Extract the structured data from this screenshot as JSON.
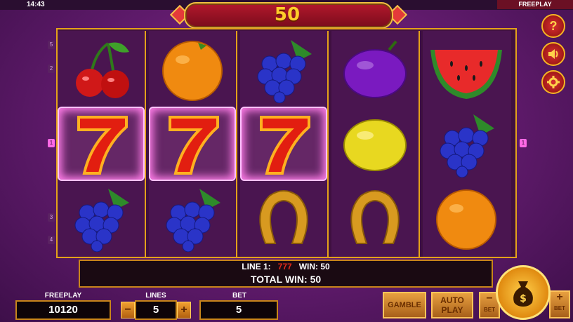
{
  "status": {
    "time": "14:43",
    "mode_label": "FREEPLAY"
  },
  "win_banner": {
    "value": "50"
  },
  "line_markers_left": [
    "5",
    "2",
    "1",
    "3",
    "4"
  ],
  "line_markers_right": [
    "1"
  ],
  "reels": [
    [
      "cherry",
      "seven",
      "grapes"
    ],
    [
      "orange",
      "seven",
      "grapes"
    ],
    [
      "grapes",
      "seven",
      "horseshoe"
    ],
    [
      "plum",
      "lemon",
      "horseshoe"
    ],
    [
      "watermelon",
      "grapes",
      "orange"
    ]
  ],
  "seven_glyph": "7",
  "right_buttons": {
    "help": "?",
    "sound_icon": "speaker-icon",
    "settings_icon": "gear-icon"
  },
  "win_info": {
    "line_label": "LINE 1:",
    "line_symbols": "777",
    "win_label": "WIN: 50",
    "total": "TOTAL WIN: 50"
  },
  "balance": {
    "label": "FREEPLAY",
    "value": "10120"
  },
  "lines": {
    "label": "LINES",
    "value": "5",
    "minus": "−",
    "plus": "+"
  },
  "bet": {
    "label": "BET",
    "value": "5"
  },
  "buttons": {
    "gamble": "GAMBLE",
    "auto_play_1": "AUTO",
    "auto_play_2": "PLAY",
    "bet_minus": "−",
    "bet_minus_label": "BET",
    "bet_plus": "+",
    "bet_plus_label": "BET"
  },
  "colors": {
    "accent": "#e4a21a",
    "background": "#6a1d74",
    "highlight": "#ff7de8"
  }
}
